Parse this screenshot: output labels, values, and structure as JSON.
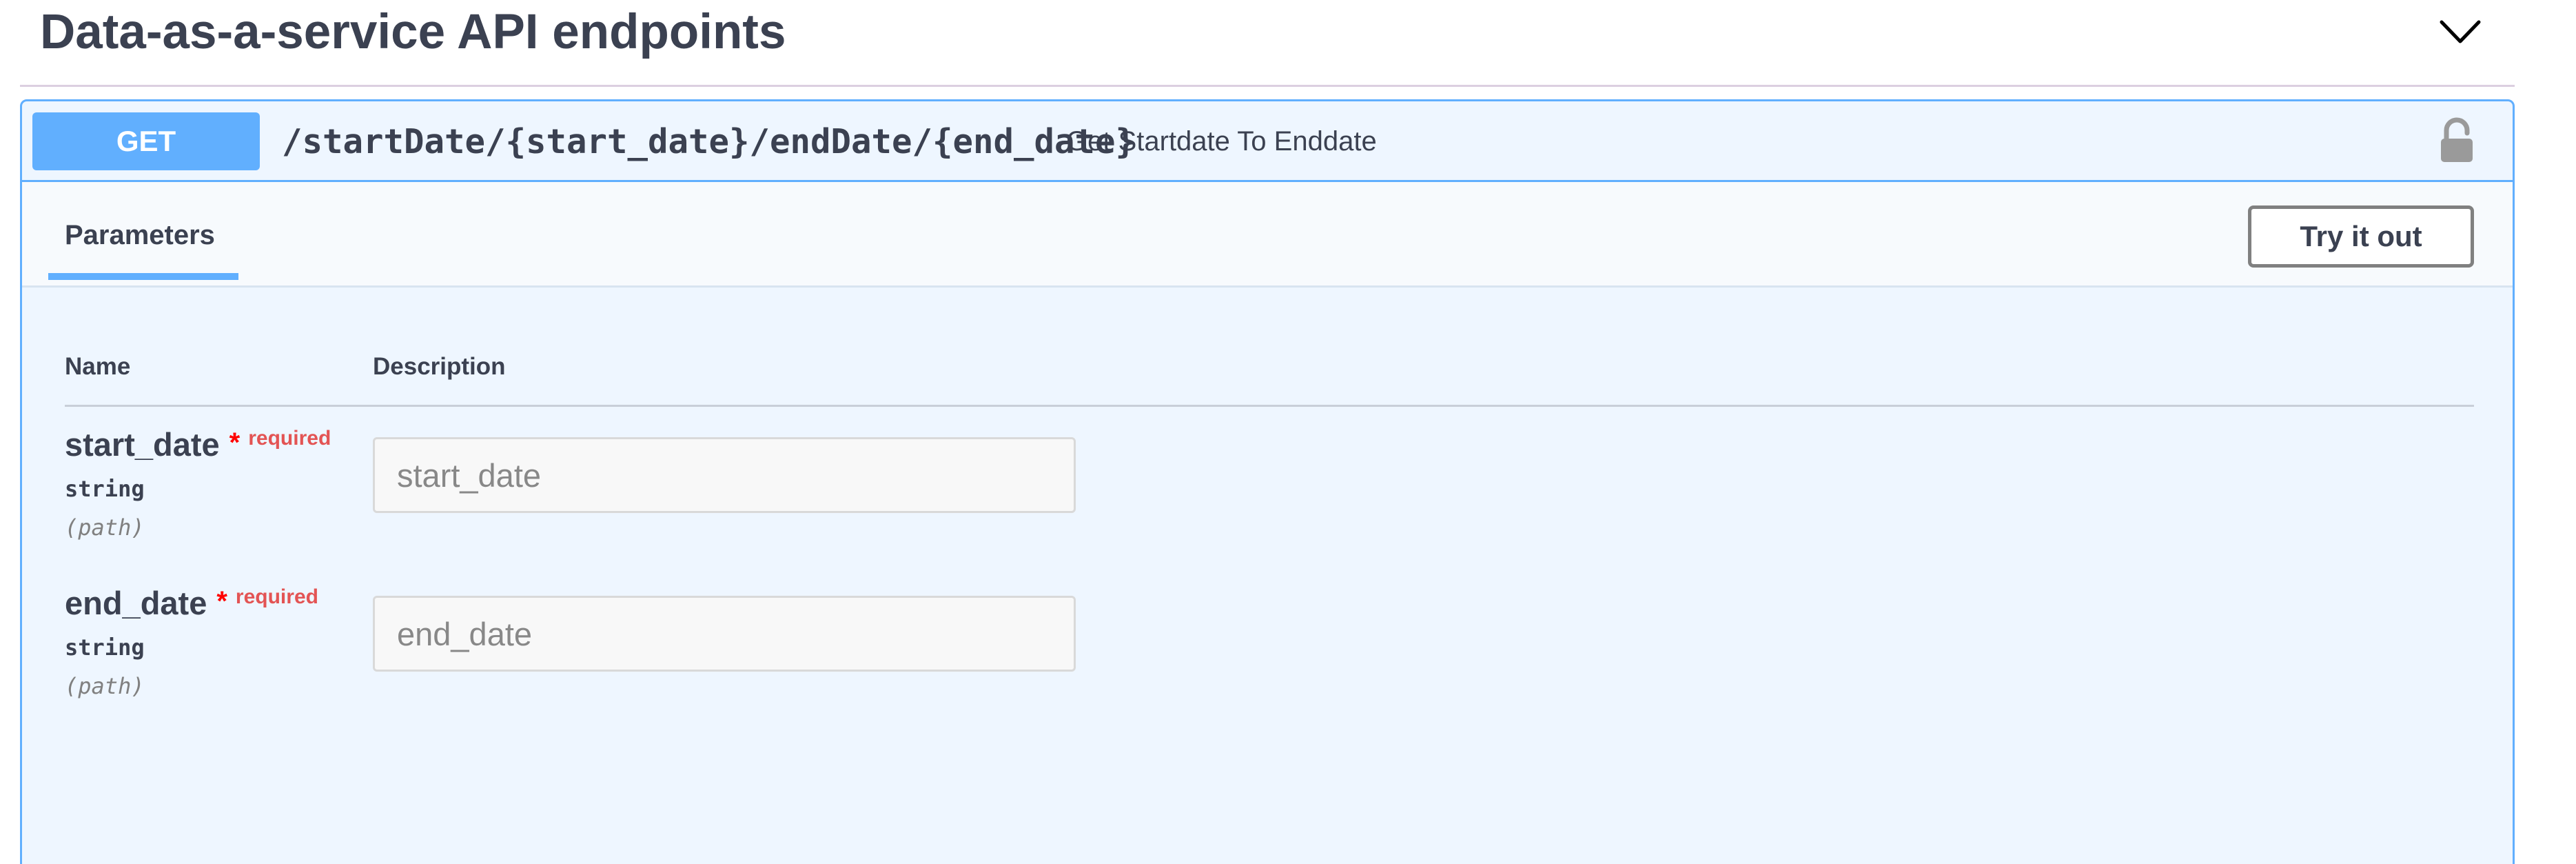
{
  "tag": {
    "title": "Data-as-a-service API endpoints"
  },
  "operation": {
    "method": "GET",
    "path": "/startDate/{start_date}/endDate/{end_date}",
    "summary": "Get Startdate To Enddate",
    "method_color": "#61affe"
  },
  "section": {
    "tab_parameters": "Parameters",
    "try_it_out": "Try it out"
  },
  "table": {
    "col_name": "Name",
    "col_description": "Description"
  },
  "params": [
    {
      "name": "start_date",
      "star": "*",
      "required": "required",
      "type": "string",
      "in": "(path)",
      "placeholder": "start_date"
    },
    {
      "name": "end_date",
      "star": "*",
      "required": "required",
      "type": "string",
      "in": "(path)",
      "placeholder": "end_date"
    }
  ]
}
